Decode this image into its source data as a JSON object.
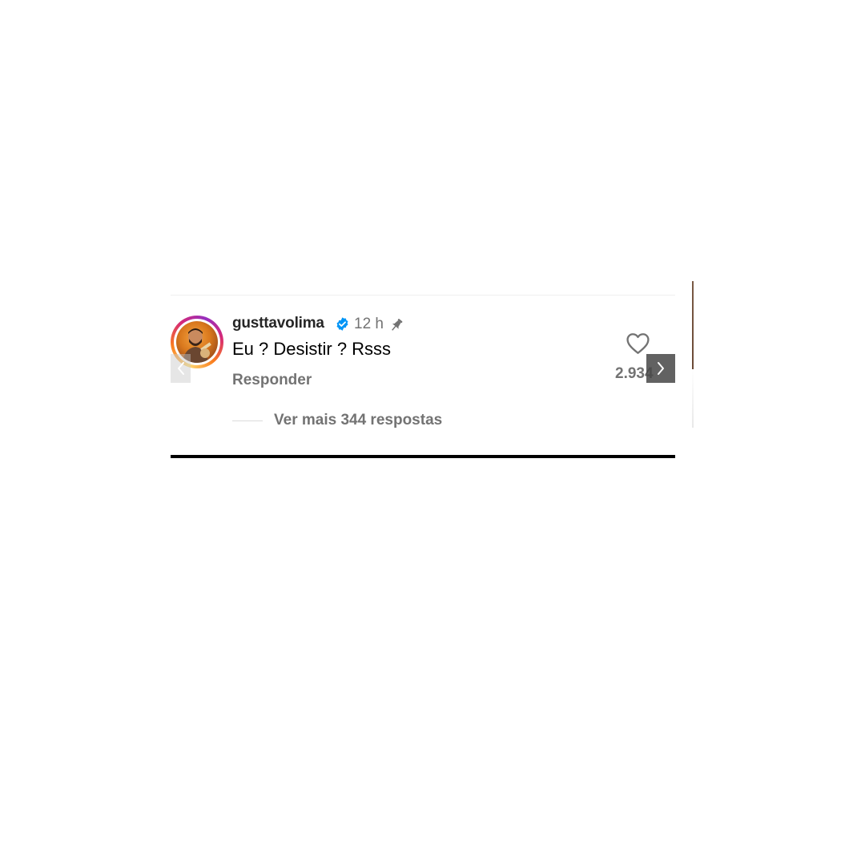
{
  "comment": {
    "username": "gusttavolima",
    "verified": true,
    "time": "12 h",
    "pinned": true,
    "text": "Eu ? Desistir ? Rsss",
    "reply_label": "Responder",
    "likes": "2.934",
    "view_replies_label": "Ver mais 344 respostas"
  },
  "icons": {
    "verified": "verified-badge-icon",
    "pin": "pin-icon",
    "like": "heart-outline-icon",
    "prev": "chevron-left-icon",
    "next": "chevron-right-icon"
  },
  "colors": {
    "verified_blue": "#0095f6",
    "secondary_text": "#737373",
    "primary_text": "#262626"
  }
}
